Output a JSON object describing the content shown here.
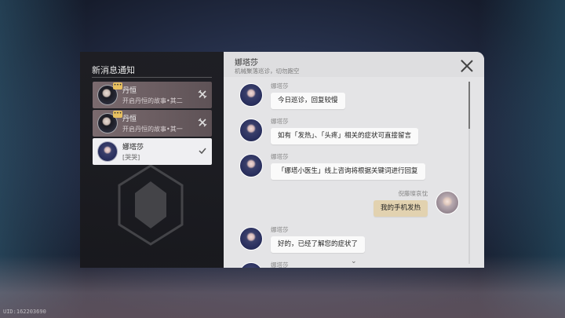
{
  "uid": "UID:162203690",
  "notifications": {
    "title": "新消息通知",
    "items": [
      {
        "name": "丹恒",
        "preview": "开启丹恒的故事•其二",
        "state": "dim",
        "action": "dismiss-icon",
        "badge": "•••"
      },
      {
        "name": "丹恒",
        "preview": "开启丹恒的故事•其一",
        "state": "dim",
        "action": "dismiss-icon",
        "badge": "•••"
      },
      {
        "name": "娜塔莎",
        "preview": "[哭哭]",
        "state": "active",
        "action": "check-icon"
      }
    ]
  },
  "chat": {
    "title": "娜塔莎",
    "subtitle": "机械聚落巡诊，切勿跑空",
    "messages": [
      {
        "sender": "娜塔莎",
        "text": "今日巡诊，回复较慢",
        "side": "left"
      },
      {
        "sender": "娜塔莎",
        "text": "如有「发热」、「头疼」相关的症状可直接留言",
        "side": "left"
      },
      {
        "sender": "娜塔莎",
        "text": "「娜塔小医生」线上咨询将根据关键词进行回复",
        "side": "left"
      },
      {
        "sender": "倪藤璨哀忱",
        "text": "我的手机发热",
        "side": "right"
      },
      {
        "sender": "娜塔莎",
        "text": "好的，已经了解您的症状了",
        "side": "left"
      },
      {
        "sender": "娜塔莎",
        "text": "",
        "side": "left"
      }
    ],
    "more_indicator": "⌄"
  },
  "colors": {
    "active_notif": "#efeff2",
    "dim_notif": "#7a6a6e",
    "chat_bg": "#e4e4e6",
    "user_bubble": "#e2d2b0"
  }
}
